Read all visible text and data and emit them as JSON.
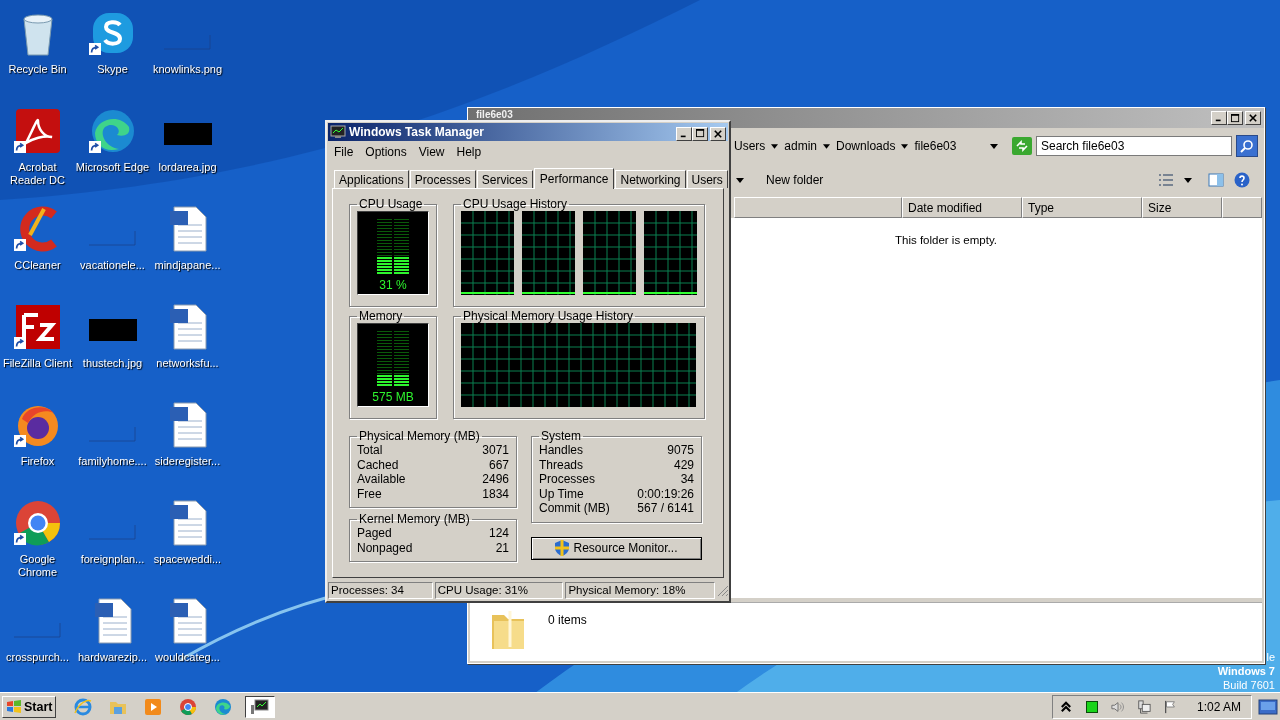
{
  "desktop": {
    "icons": [
      {
        "label": "Recycle Bin",
        "kind": "recycle",
        "shortcut": false
      },
      {
        "label": "Acrobat Reader DC",
        "kind": "acrobat",
        "shortcut": true
      },
      {
        "label": "CCleaner",
        "kind": "ccleaner",
        "shortcut": true
      },
      {
        "label": "FileZilla Client",
        "kind": "filezilla",
        "shortcut": true
      },
      {
        "label": "Firefox",
        "kind": "firefox",
        "shortcut": true
      },
      {
        "label": "Google Chrome",
        "kind": "chrome",
        "shortcut": true
      },
      {
        "label": "crosspurch...",
        "kind": "blank",
        "shortcut": false
      },
      {
        "label": "Skype",
        "kind": "skype",
        "shortcut": true
      },
      {
        "label": "Microsoft Edge",
        "kind": "edge",
        "shortcut": true
      },
      {
        "label": "vacationele...",
        "kind": "blank",
        "shortcut": false
      },
      {
        "label": "thustech.jpg",
        "kind": "black",
        "shortcut": false
      },
      {
        "label": "familyhome....",
        "kind": "blank",
        "shortcut": false
      },
      {
        "label": "foreignplan...",
        "kind": "blank",
        "shortcut": false
      },
      {
        "label": "hardwarezip...",
        "kind": "doc",
        "shortcut": false
      },
      {
        "label": "knowlinks.png",
        "kind": "blank",
        "shortcut": false
      },
      {
        "label": "lordarea.jpg",
        "kind": "black",
        "shortcut": false
      },
      {
        "label": "mindjapane...",
        "kind": "doc",
        "shortcut": false
      },
      {
        "label": "networksfu...",
        "kind": "doc",
        "shortcut": false
      },
      {
        "label": "sideregister...",
        "kind": "doc",
        "shortcut": false
      },
      {
        "label": "spaceweddi...",
        "kind": "doc",
        "shortcut": false
      },
      {
        "label": "wouldcateg...",
        "kind": "doc",
        "shortcut": false
      }
    ],
    "os_label": [
      "le",
      "Windows 7",
      "Build 7601"
    ]
  },
  "explorer": {
    "title": "file6e03",
    "breadcrumbs": [
      "Users",
      "admin",
      "Downloads",
      "file6e03"
    ],
    "search": {
      "placeholder": "Search file6e03"
    },
    "toolbar": [
      "New folder"
    ],
    "columns": [
      "Date modified",
      "Type",
      "Size"
    ],
    "empty_message": "This folder is empty.",
    "status": "0 items"
  },
  "task_manager": {
    "title": "Windows Task Manager",
    "menu": [
      "File",
      "Options",
      "View",
      "Help"
    ],
    "tabs": [
      {
        "label": "Applications",
        "selected": false
      },
      {
        "label": "Processes",
        "selected": false
      },
      {
        "label": "Services",
        "selected": false
      },
      {
        "label": "Performance",
        "selected": true
      },
      {
        "label": "Networking",
        "selected": false
      },
      {
        "label": "Users",
        "selected": false
      }
    ],
    "cpu": {
      "title": "CPU Usage",
      "level": 0.31,
      "reading": "31 %"
    },
    "cpu_history": {
      "title": "CPU Usage History"
    },
    "memory": {
      "title": "Memory",
      "level": 0.19,
      "reading": "575 MB"
    },
    "memory_history": {
      "title": "Physical Memory Usage History"
    },
    "physical_memory": {
      "title": "Physical Memory (MB)",
      "rows": [
        {
          "label": "Total",
          "value": "3071"
        },
        {
          "label": "Cached",
          "value": "667"
        },
        {
          "label": "Available",
          "value": "2496"
        },
        {
          "label": "Free",
          "value": "1834"
        }
      ]
    },
    "kernel_memory": {
      "title": "Kernel Memory (MB)",
      "rows": [
        {
          "label": "Paged",
          "value": "124"
        },
        {
          "label": "Nonpaged",
          "value": "21"
        }
      ]
    },
    "system": {
      "title": "System",
      "rows": [
        {
          "label": "Handles",
          "value": "9075"
        },
        {
          "label": "Threads",
          "value": "429"
        },
        {
          "label": "Processes",
          "value": "34"
        },
        {
          "label": "Up Time",
          "value": "0:00:19:26"
        },
        {
          "label": "Commit (MB)",
          "value": "567 / 6141"
        }
      ]
    },
    "button": "Resource Monitor...",
    "status_bar": [
      "Processes: 34",
      "CPU Usage: 31%",
      "Physical Memory: 18%"
    ]
  },
  "taskbar": {
    "start": "Start",
    "apps": [
      {
        "kind": "ie",
        "active": false
      },
      {
        "kind": "explorer",
        "active": false
      },
      {
        "kind": "media",
        "active": false
      },
      {
        "kind": "chrome",
        "active": false
      },
      {
        "kind": "edge",
        "active": false
      },
      {
        "kind": "taskmgr",
        "active": true
      }
    ],
    "clock": "1:02 AM"
  }
}
